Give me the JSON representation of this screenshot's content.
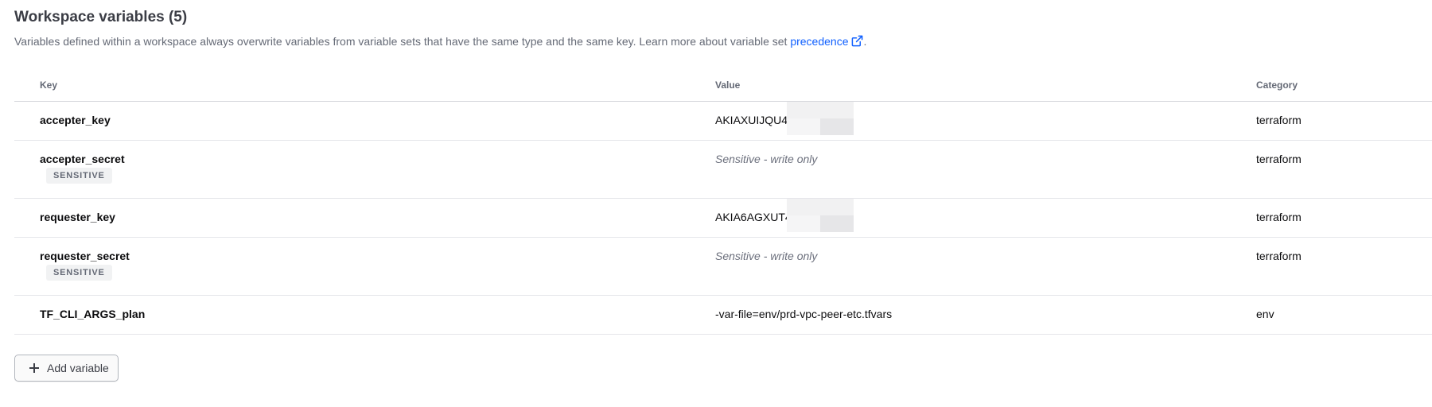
{
  "header": {
    "title": "Workspace variables (5)",
    "description": "Variables defined within a workspace always overwrite variables from variable sets that have the same type and the same key. Learn more about variable set ",
    "link_text": "precedence",
    "link_suffix": "."
  },
  "table": {
    "columns": {
      "key": "Key",
      "value": "Value",
      "category": "Category"
    },
    "rows": [
      {
        "key": "accepter_key",
        "value": "AKIAXUIJQU4",
        "category": "terraform",
        "sensitive": false
      },
      {
        "key": "accepter_secret",
        "value": "Sensitive - write only",
        "category": "terraform",
        "sensitive": true,
        "badge": "SENSITIVE"
      },
      {
        "key": "requester_key",
        "value": "AKIA6AGXUT4",
        "category": "terraform",
        "sensitive": false
      },
      {
        "key": "requester_secret",
        "value": "Sensitive - write only",
        "category": "terraform",
        "sensitive": true,
        "badge": "SENSITIVE"
      },
      {
        "key": "TF_CLI_ARGS_plan",
        "value": "-var-file=env/prd-vpc-peer-etc.tfvars",
        "category": "env",
        "sensitive": false
      }
    ]
  },
  "actions": {
    "add_variable_label": "Add variable"
  },
  "icons": {
    "external_link": "external-link-icon",
    "add": "plus-icon"
  },
  "colors": {
    "link": "#1060ff",
    "badge_bg": "#f1f2f3"
  }
}
